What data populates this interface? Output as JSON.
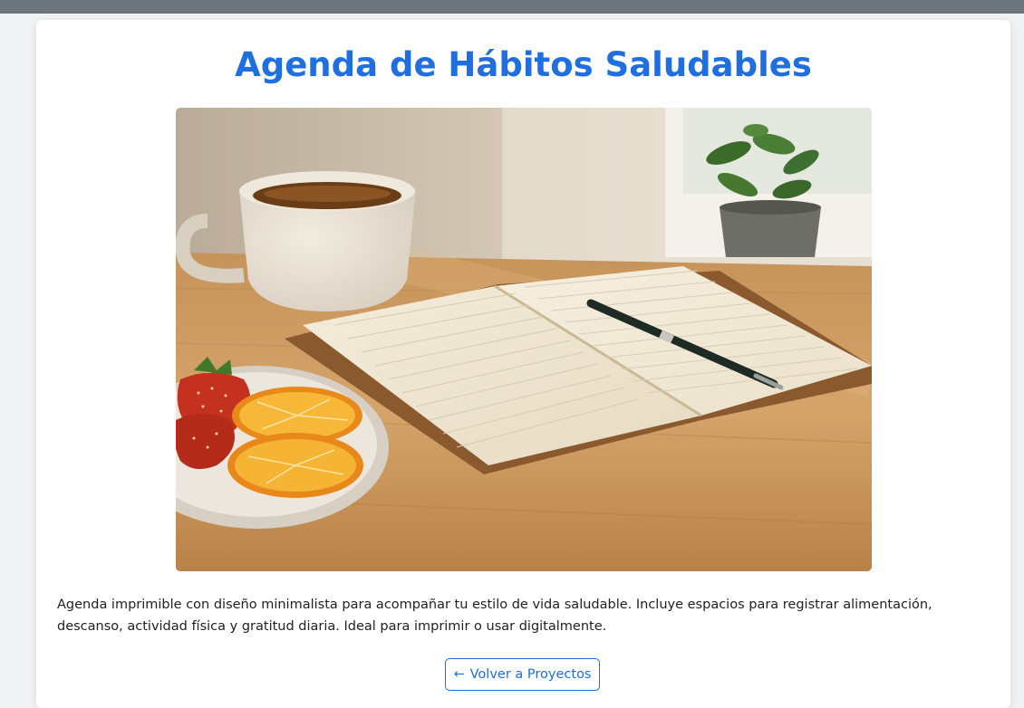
{
  "page": {
    "title": "Agenda de Hábitos Saludables",
    "description": "Agenda imprimible con diseño minimalista para acompañar tu estilo de vida saludable. Incluye espacios para registrar alimentación, descanso, actividad física y gratitud diaria. Ideal para imprimir o usar digitalmente.",
    "back_button": {
      "arrow": "←",
      "label": "Volver a Proyectos"
    }
  },
  "colors": {
    "accent": "#1f6fe0",
    "top_bar": "#6c757d",
    "page_background": "#f1f2f4"
  },
  "hero_image": {
    "icon": "photo-notebook-tea-fruit"
  }
}
